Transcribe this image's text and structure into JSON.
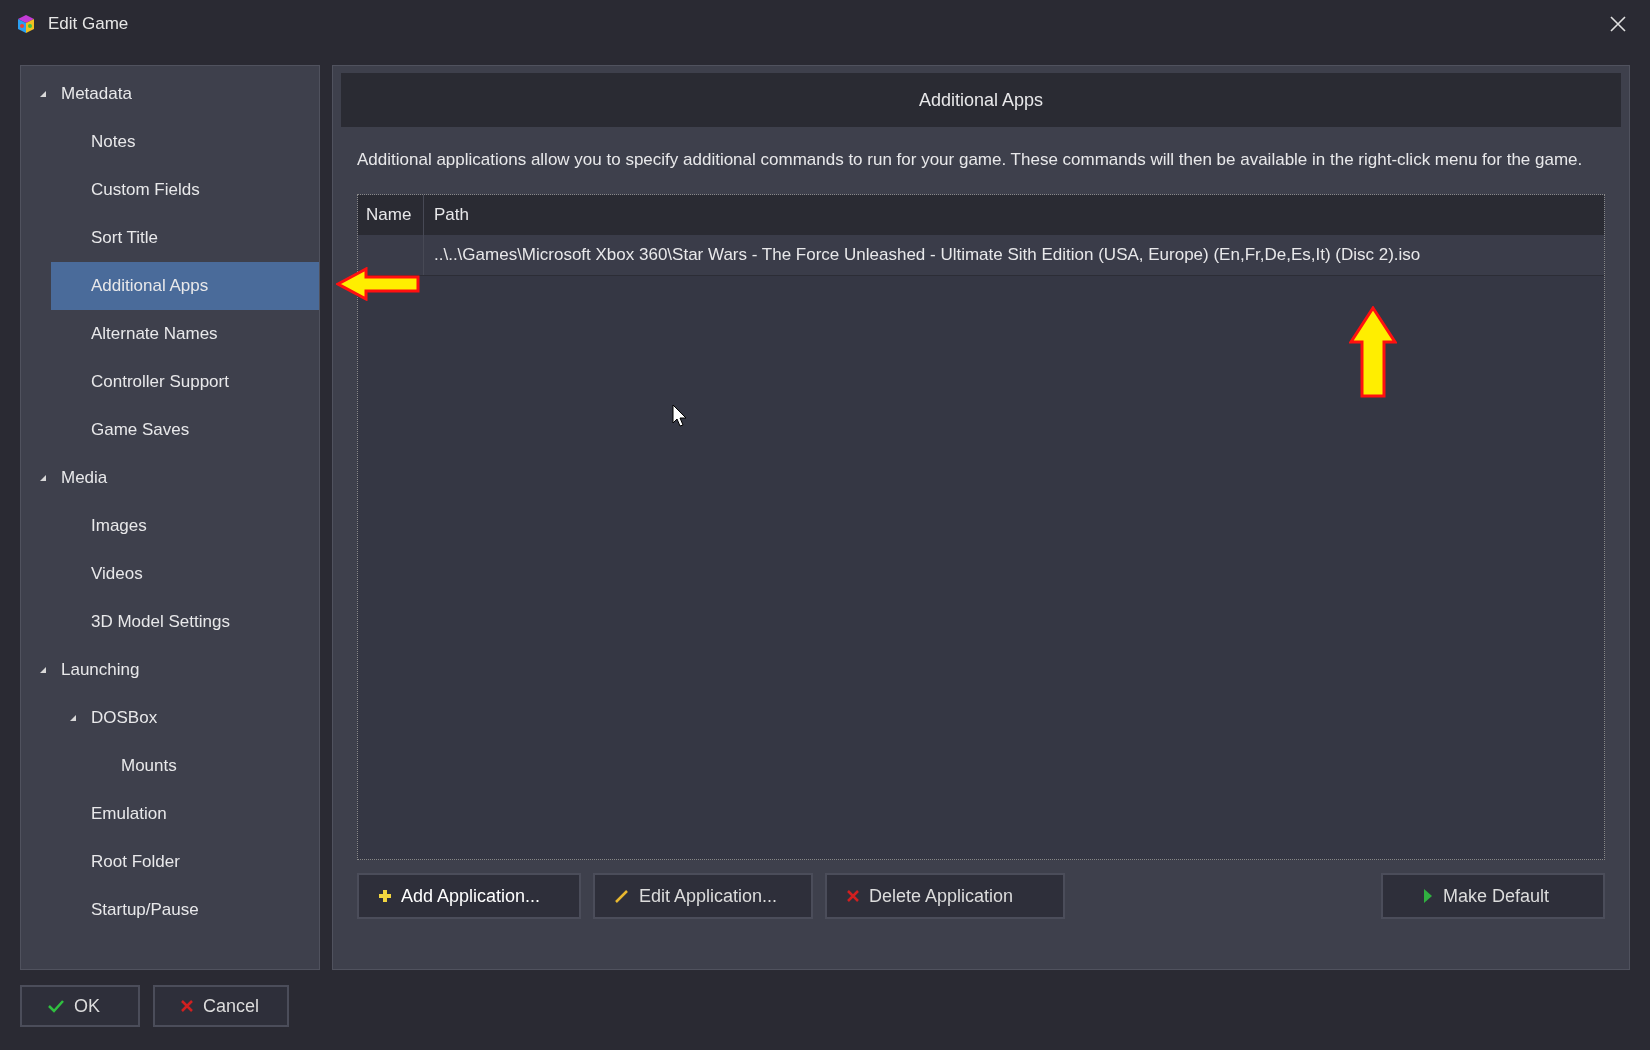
{
  "window": {
    "title": "Edit Game"
  },
  "tree": [
    {
      "label": "Metadata",
      "expanded": true,
      "selected": false,
      "children": [
        {
          "label": "Notes",
          "selected": false
        },
        {
          "label": "Custom Fields",
          "selected": false
        },
        {
          "label": "Sort Title",
          "selected": false
        },
        {
          "label": "Additional Apps",
          "selected": true
        },
        {
          "label": "Alternate Names",
          "selected": false
        },
        {
          "label": "Controller Support",
          "selected": false
        },
        {
          "label": "Game Saves",
          "selected": false
        }
      ]
    },
    {
      "label": "Media",
      "expanded": true,
      "selected": false,
      "children": [
        {
          "label": "Images",
          "selected": false
        },
        {
          "label": "Videos",
          "selected": false
        },
        {
          "label": "3D Model Settings",
          "selected": false
        }
      ]
    },
    {
      "label": "Launching",
      "expanded": true,
      "selected": false,
      "children": [
        {
          "label": "DOSBox",
          "expanded": true,
          "selected": false,
          "children": [
            {
              "label": "Mounts",
              "selected": false
            }
          ]
        },
        {
          "label": "Emulation",
          "selected": false
        },
        {
          "label": "Root Folder",
          "selected": false
        },
        {
          "label": "Startup/Pause",
          "selected": false
        }
      ]
    }
  ],
  "panel": {
    "title": "Additional Apps",
    "description": "Additional applications allow you to specify additional commands to run for your game.  These commands will then be available in the right-click menu for the game.",
    "table": {
      "columns": [
        "Name",
        "Path"
      ],
      "rows": [
        {
          "name_cell": "",
          "path": "..\\..\\Games\\Microsoft Xbox 360\\Star Wars - The Force Unleashed - Ultimate Sith Edition (USA, Europe) (En,Fr,De,Es,It) (Disc 2).iso"
        }
      ]
    },
    "buttons": [
      {
        "kind": "add",
        "label": "Add Application..."
      },
      {
        "kind": "edit",
        "label": "Edit Application..."
      },
      {
        "kind": "delete",
        "label": "Delete Application"
      },
      {
        "kind": "default",
        "label": "Make Default"
      }
    ]
  },
  "footer_buttons": [
    {
      "kind": "ok",
      "label": "OK"
    },
    {
      "kind": "cancel",
      "label": "Cancel"
    }
  ]
}
